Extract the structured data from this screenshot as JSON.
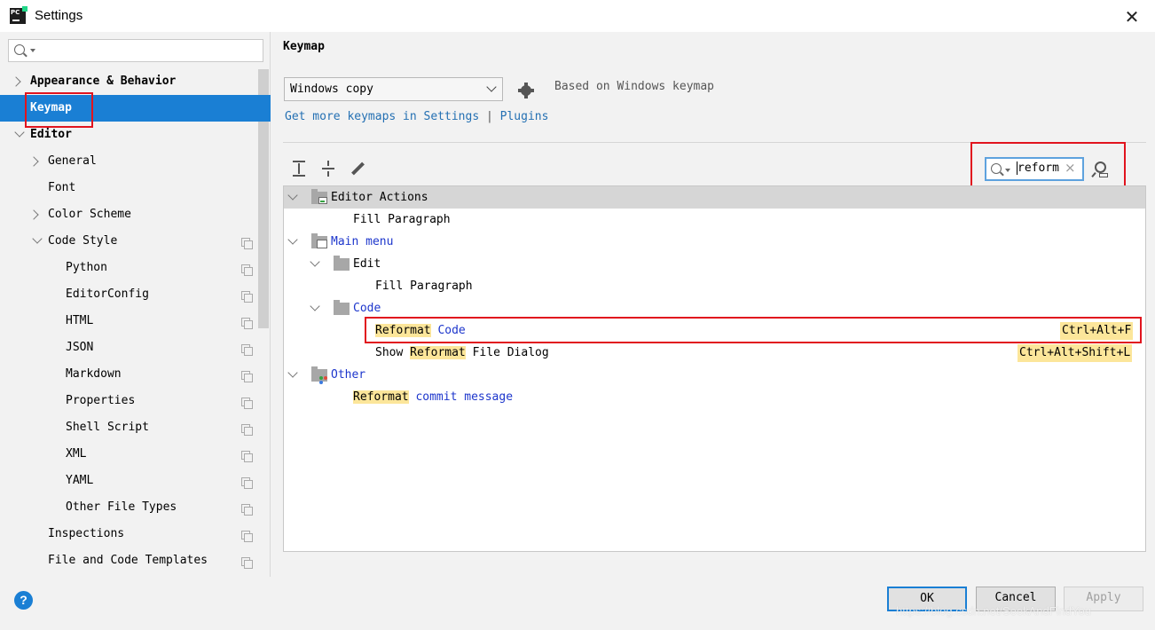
{
  "window": {
    "title": "Settings",
    "logo_text": "PC"
  },
  "sidebar": {
    "search": {
      "value": "",
      "placeholder": ""
    },
    "items": [
      {
        "label": "Appearance & Behavior"
      },
      {
        "label": "Keymap"
      },
      {
        "label": "Editor"
      },
      {
        "label": "General"
      },
      {
        "label": "Font"
      },
      {
        "label": "Color Scheme"
      },
      {
        "label": "Code Style"
      },
      {
        "label": "Python"
      },
      {
        "label": "EditorConfig"
      },
      {
        "label": "HTML"
      },
      {
        "label": "JSON"
      },
      {
        "label": "Markdown"
      },
      {
        "label": "Properties"
      },
      {
        "label": "Shell Script"
      },
      {
        "label": "XML"
      },
      {
        "label": "YAML"
      },
      {
        "label": "Other File Types"
      },
      {
        "label": "Inspections"
      },
      {
        "label": "File and Code Templates"
      }
    ]
  },
  "main": {
    "title": "Keymap",
    "keymap_select": {
      "value": "Windows copy"
    },
    "based_on": "Based on Windows keymap",
    "get_more": "Get more keymaps in Settings",
    "separator": "|",
    "plugins": "Plugins",
    "search": {
      "value": "reform"
    },
    "tree": {
      "editor_actions": "Editor Actions",
      "fill_paragraph_1": "Fill Paragraph",
      "main_menu": "Main menu",
      "edit": "Edit",
      "fill_paragraph_2": "Fill Paragraph",
      "code": "Code",
      "reformat_code": {
        "hl": "Reformat",
        "rest": "Code",
        "shortcut": "Ctrl+Alt+F"
      },
      "show_reformat": {
        "pre": "Show",
        "hl": "Reformat",
        "rest": "File Dialog",
        "shortcut": "Ctrl+Alt+Shift+L"
      },
      "other": "Other",
      "reformat_commit": {
        "hl": "Reformat",
        "rest": "commit message"
      }
    }
  },
  "footer": {
    "help": "?",
    "ok": "OK",
    "cancel": "Cancel",
    "apply": "Apply",
    "watermark": "https://blog.csdn.net/SeekAndFindYou"
  },
  "colors": {
    "selection": "#1a7fd4",
    "highlight": "#fce69a",
    "link": "#2470b3",
    "annotation_box": "#e1141e"
  }
}
